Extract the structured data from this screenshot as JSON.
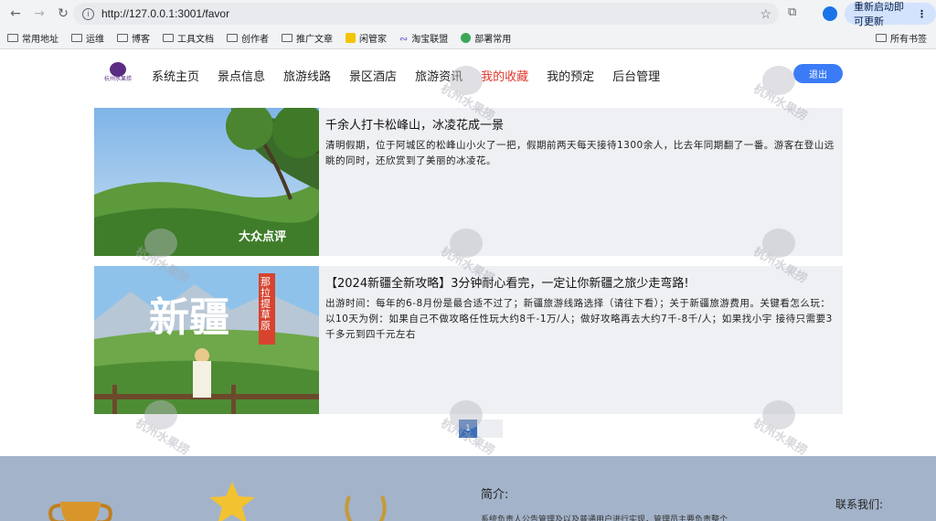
{
  "browser": {
    "url": "http://127.0.0.1:3001/favor",
    "restart_label": "重新启动即可更新",
    "bookmarks": [
      "常用地址",
      "运维",
      "博客",
      "工具文档",
      "创作者",
      "推广文章",
      "闲管家",
      "淘宝联盟",
      "部署常用"
    ],
    "all_bookmarks_label": "所有书签"
  },
  "site": {
    "logo_text": "杭州水果捞",
    "logo_sub": "HZFRUIT",
    "nav": [
      "系统主页",
      "景点信息",
      "旅游线路",
      "景区酒店",
      "旅游资讯",
      "我的收藏",
      "我的预定",
      "后台管理"
    ],
    "active_nav": "我的收藏",
    "logout_label": "退出"
  },
  "favorites": [
    {
      "title": "千余人打卡松峰山，冰凌花成一景",
      "desc": "清明假期，位于阿城区的松峰山小火了一把，假期前两天每天接待1300余人，比去年同期翻了一番。游客在登山远眺的同时，还欣赏到了美丽的冰凌花。",
      "image_caption": "大众点评"
    },
    {
      "title": "【2024新疆全新攻略】3分钟耐心看完，一定让你新疆之旅少走弯路!",
      "desc": "出游时间：每年的6-8月份是最合适不过了；新疆旅游线路选择（请往下看）；关于新疆旅游费用。关键看怎么玩：以10天为例：如果自己不做攻略任性玩大约8千-1万/人；做好攻略再去大约7千-8千/人；如果找小宇 接待只需要3千多元到四千元左右",
      "image_caption": "新疆",
      "image_caption_side": "那拉提草原"
    }
  ],
  "pager": {
    "current": "1"
  },
  "footer": {
    "intro_title": "简介:",
    "contact_title": "联系我们:",
    "intro_text": "系统负责人公告管理及以及普通用户进行实现，管理员主要负责整个"
  },
  "watermark": {
    "line1": "杭州水果捞",
    "line2": "HZFRUIT"
  },
  "colors": {
    "active": "#e0362c",
    "button": "#3b7cf6",
    "card_bg": "#eff0f3",
    "footer_bg": "#a3b3c9",
    "pager": "#3a6fb8"
  }
}
